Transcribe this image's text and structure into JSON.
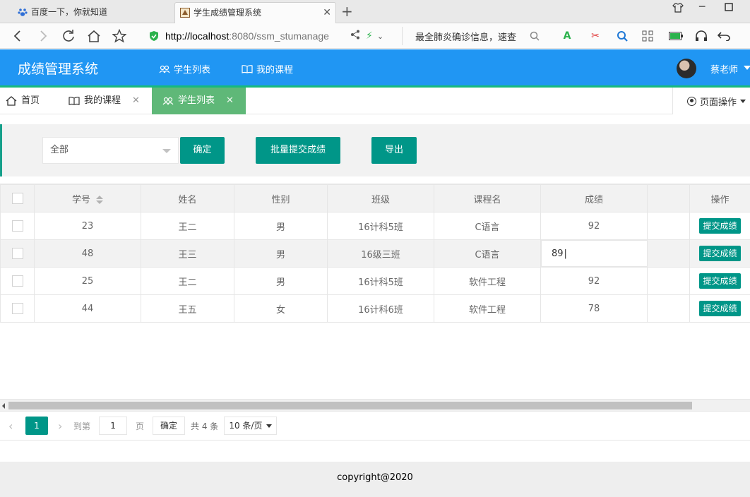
{
  "browser": {
    "tabs": [
      {
        "title": "百度一下，你就知道"
      },
      {
        "title": "学生成绩管理系统"
      }
    ],
    "url_host": "http://localhost",
    "url_rest": ":8080/ssm_stumanage",
    "search_news": "最全肺炎确诊信息，速查"
  },
  "app": {
    "title": "成绩管理系统",
    "nav": [
      {
        "label": "学生列表"
      },
      {
        "label": "我的课程"
      }
    ],
    "user": "蔡老师"
  },
  "page_tabs": [
    {
      "label": "首页"
    },
    {
      "label": "我的课程"
    },
    {
      "label": "学生列表"
    }
  ],
  "page_ops": "页面操作",
  "toolbar": {
    "select_value": "全部",
    "confirm": "确定",
    "batch_submit": "批量提交成绩",
    "export": "导出"
  },
  "table": {
    "headers": [
      "学号",
      "姓名",
      "性别",
      "班级",
      "课程名",
      "成绩",
      "操作"
    ],
    "rows": [
      {
        "id": "23",
        "name": "王二",
        "gender": "男",
        "class": "16计科5班",
        "course": "C语言",
        "score": "92",
        "action": "提交成绩"
      },
      {
        "id": "48",
        "name": "王三",
        "gender": "男",
        "class": "16级三班",
        "course": "C语言",
        "score": "89",
        "action": "提交成绩"
      },
      {
        "id": "25",
        "name": "王二",
        "gender": "男",
        "class": "16计科5班",
        "course": "软件工程",
        "score": "92",
        "action": "提交成绩"
      },
      {
        "id": "44",
        "name": "王五",
        "gender": "女",
        "class": "16计科6班",
        "course": "软件工程",
        "score": "78",
        "action": "提交成绩"
      }
    ]
  },
  "pager": {
    "current": "1",
    "goto_label": "到第",
    "page_input": "1",
    "page_unit": "页",
    "ok": "确定",
    "total": "共 4 条",
    "page_size": "10 条/页"
  },
  "footer": "copyright@2020",
  "colors": {
    "header_blue": "#2096f3",
    "accent_teal": "#009688",
    "tab_green": "#5fb878",
    "header_underline": "#16b97e"
  }
}
